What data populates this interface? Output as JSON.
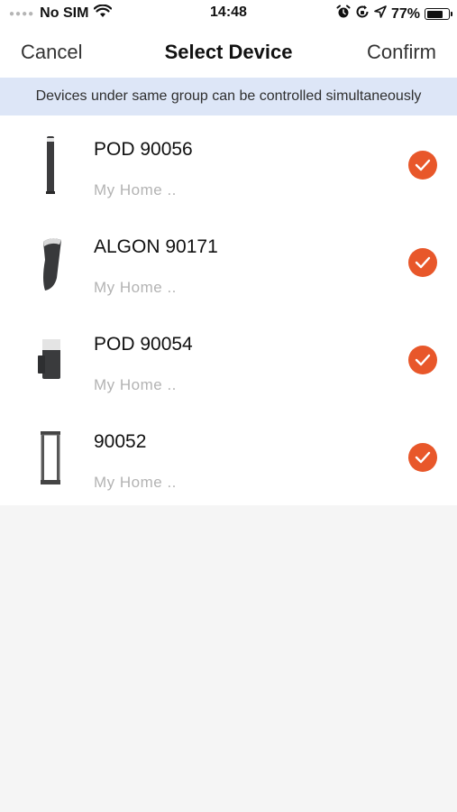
{
  "status_bar": {
    "carrier": "No SIM",
    "time": "14:48",
    "battery": "77%",
    "battery_level": 0.77
  },
  "nav": {
    "cancel_label": "Cancel",
    "title": "Select Device",
    "confirm_label": "Confirm"
  },
  "notice": "Devices under same group can be controlled simultaneously",
  "devices": [
    {
      "name": "POD 90056",
      "location": "My Home ..",
      "selected": true,
      "icon": "bollard-light-icon"
    },
    {
      "name": "ALGON 90171",
      "location": "My Home ..",
      "selected": true,
      "icon": "angled-bollard-light-icon"
    },
    {
      "name": "POD 90054",
      "location": "My Home ..",
      "selected": true,
      "icon": "wall-light-icon"
    },
    {
      "name": "90052",
      "location": "My Home ..",
      "selected": true,
      "icon": "lantern-post-light-icon"
    }
  ],
  "colors": {
    "accent": "#e8572a",
    "notice_bg": "#dde6f7",
    "page_bg": "#f5f5f5"
  }
}
